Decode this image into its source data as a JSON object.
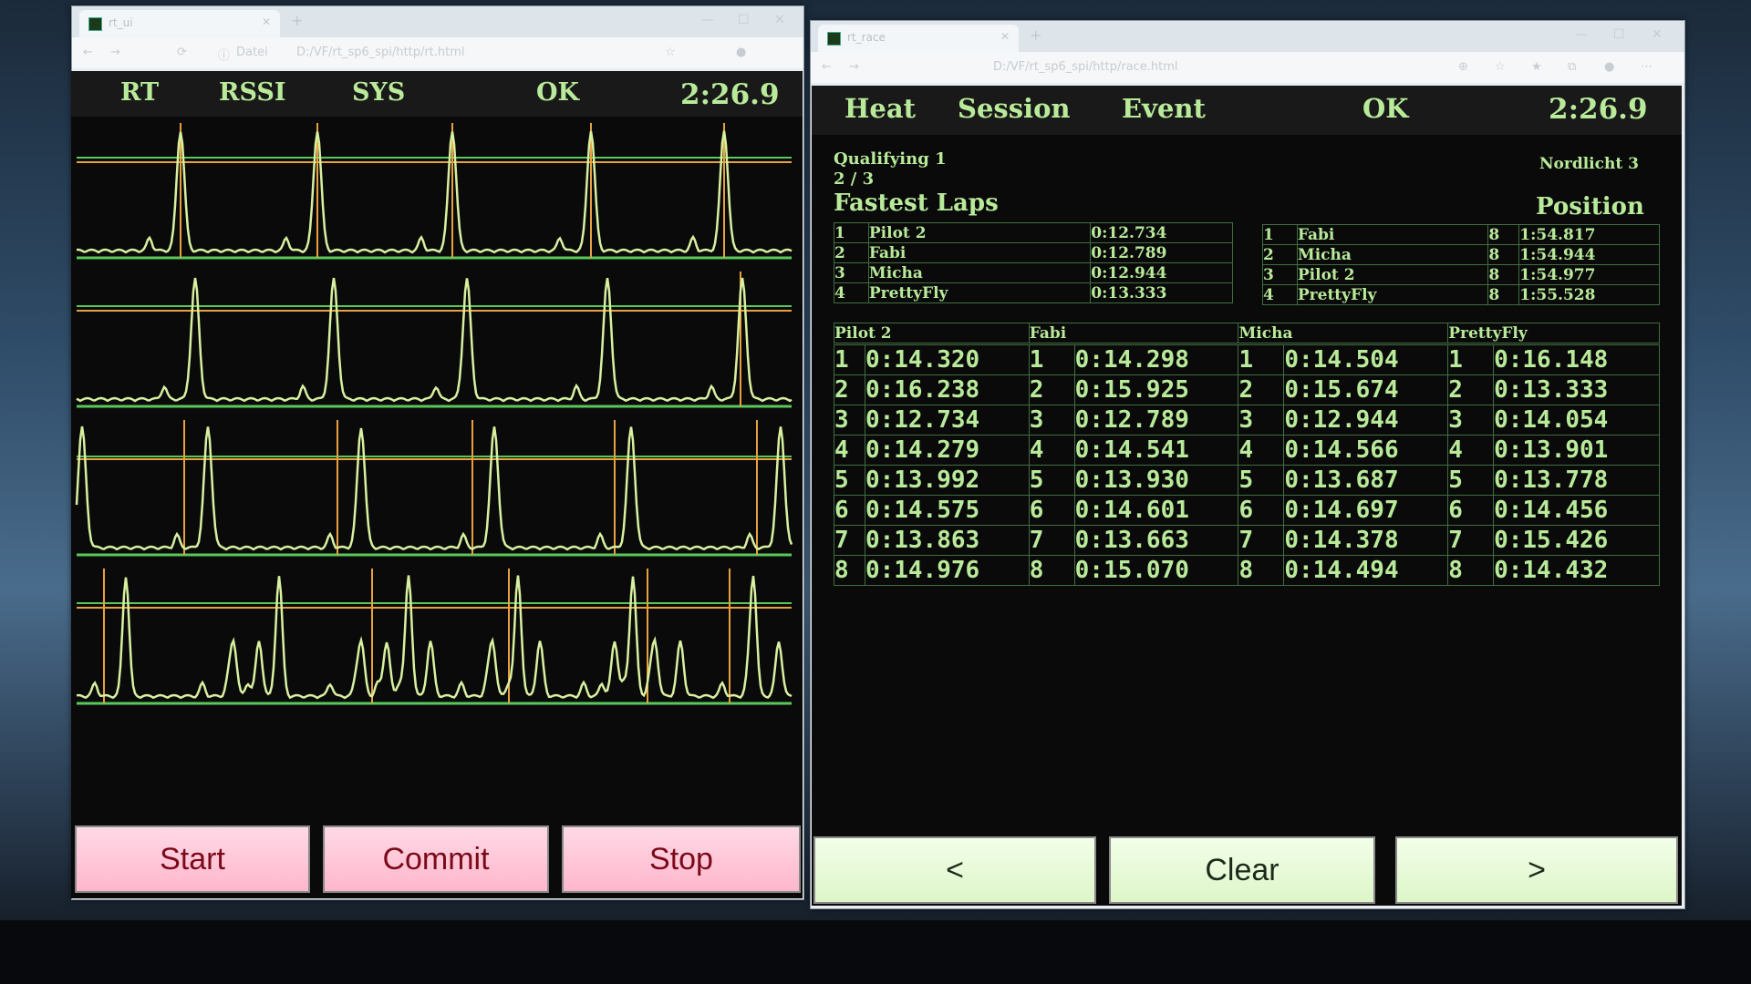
{
  "left_browser": {
    "tab_title": "rt_ui",
    "address": "D:/VF/rt_sp6_spi/http/rt.html",
    "address_prefix": "Datei"
  },
  "right_browser": {
    "tab_title": "rt_race",
    "address": "D:/VF/rt_sp6_spi/http/race.html"
  },
  "left_header": {
    "rt": "RT",
    "rssi": "RSSI",
    "sys": "SYS",
    "status": "OK",
    "time": "2:26.9"
  },
  "left_buttons": {
    "start": "Start",
    "commit": "Commit",
    "stop": "Stop"
  },
  "right_header": {
    "heat": "Heat",
    "session": "Session",
    "event": "Event",
    "status": "OK",
    "time": "2:26.9"
  },
  "race": {
    "session_label": "Qualifying 1",
    "heat_progress": "2 / 3",
    "venue": "Nordlicht 3",
    "fastest_title": "Fastest Laps",
    "position_title": "Position"
  },
  "fastest_laps": [
    {
      "rank": "1",
      "pilot": "Pilot 2",
      "time": "0:12.734"
    },
    {
      "rank": "2",
      "pilot": "Fabi",
      "time": "0:12.789"
    },
    {
      "rank": "3",
      "pilot": "Micha",
      "time": "0:12.944"
    },
    {
      "rank": "4",
      "pilot": "PrettyFly",
      "time": "0:13.333"
    }
  ],
  "positions": [
    {
      "rank": "1",
      "pilot": "Fabi",
      "laps": "8",
      "time": "1:54.817"
    },
    {
      "rank": "2",
      "pilot": "Micha",
      "laps": "8",
      "time": "1:54.944"
    },
    {
      "rank": "3",
      "pilot": "Pilot 2",
      "laps": "8",
      "time": "1:54.977"
    },
    {
      "rank": "4",
      "pilot": "PrettyFly",
      "laps": "8",
      "time": "1:55.528"
    }
  ],
  "pilot_columns": [
    {
      "name": "Pilot 2",
      "laps": [
        "0:14.320",
        "0:16.238",
        "0:12.734",
        "0:14.279",
        "0:13.992",
        "0:14.575",
        "0:13.863",
        "0:14.976"
      ]
    },
    {
      "name": "Fabi",
      "laps": [
        "0:14.298",
        "0:15.925",
        "0:12.789",
        "0:14.541",
        "0:13.930",
        "0:14.601",
        "0:13.663",
        "0:15.070"
      ]
    },
    {
      "name": "Micha",
      "laps": [
        "0:14.504",
        "0:15.674",
        "0:12.944",
        "0:14.566",
        "0:13.687",
        "0:14.697",
        "0:14.378",
        "0:14.494"
      ]
    },
    {
      "name": "PrettyFly",
      "laps": [
        "0:16.148",
        "0:13.333",
        "0:14.054",
        "0:13.901",
        "0:13.778",
        "0:14.456",
        "0:15.426",
        "0:14.432"
      ]
    }
  ],
  "nav_buttons": {
    "prev": "<",
    "clear": "Clear",
    "next": ">"
  },
  "colors": {
    "trace": "#d8f0a0",
    "threshold": "#e8a040",
    "grid": "#5ac85a",
    "text": "#b8ea9a",
    "start_btn": "#ffc0d0",
    "nav_btn": "#e6f8d4"
  }
}
